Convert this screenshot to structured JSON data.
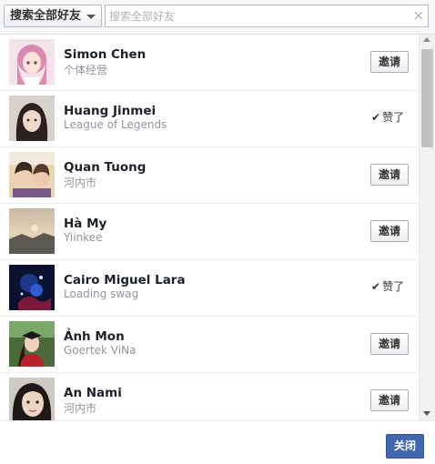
{
  "header": {
    "filter_label": "搜索全部好友",
    "search_placeholder": "搜索全部好友",
    "search_value": ""
  },
  "friends": [
    {
      "name": "Simon Chen",
      "subtitle": "个体经营",
      "status": "invite",
      "avatar": "anime-girl-pink-hair-avatar"
    },
    {
      "name": "Huang Jinmei",
      "subtitle": "League of Legends",
      "status": "sent",
      "avatar": "woman-portrait-avatar"
    },
    {
      "name": "Quan Tuong",
      "subtitle": "河内市",
      "status": "invite",
      "avatar": "couple-selfie-avatar"
    },
    {
      "name": "Hà My",
      "subtitle": "Yiinkee",
      "status": "invite",
      "avatar": "sunset-landscape-avatar"
    },
    {
      "name": "Cairo Miguel Lara",
      "subtitle": "Loading swag",
      "status": "sent",
      "avatar": "dark-blue-artwork-avatar"
    },
    {
      "name": "Ảnh Mon",
      "subtitle": "Goertek ViNa",
      "status": "invite",
      "avatar": "graduation-photo-avatar"
    },
    {
      "name": "An Nami",
      "subtitle": "河内市",
      "status": "invite",
      "avatar": "woman-face-closeup-avatar"
    }
  ],
  "labels": {
    "invite": "邀请",
    "sent": "赞了",
    "close": "关闭"
  },
  "colors": {
    "primary_button": "#4267b2",
    "subtitle_text": "#90949c",
    "name_text": "#1d2129"
  }
}
